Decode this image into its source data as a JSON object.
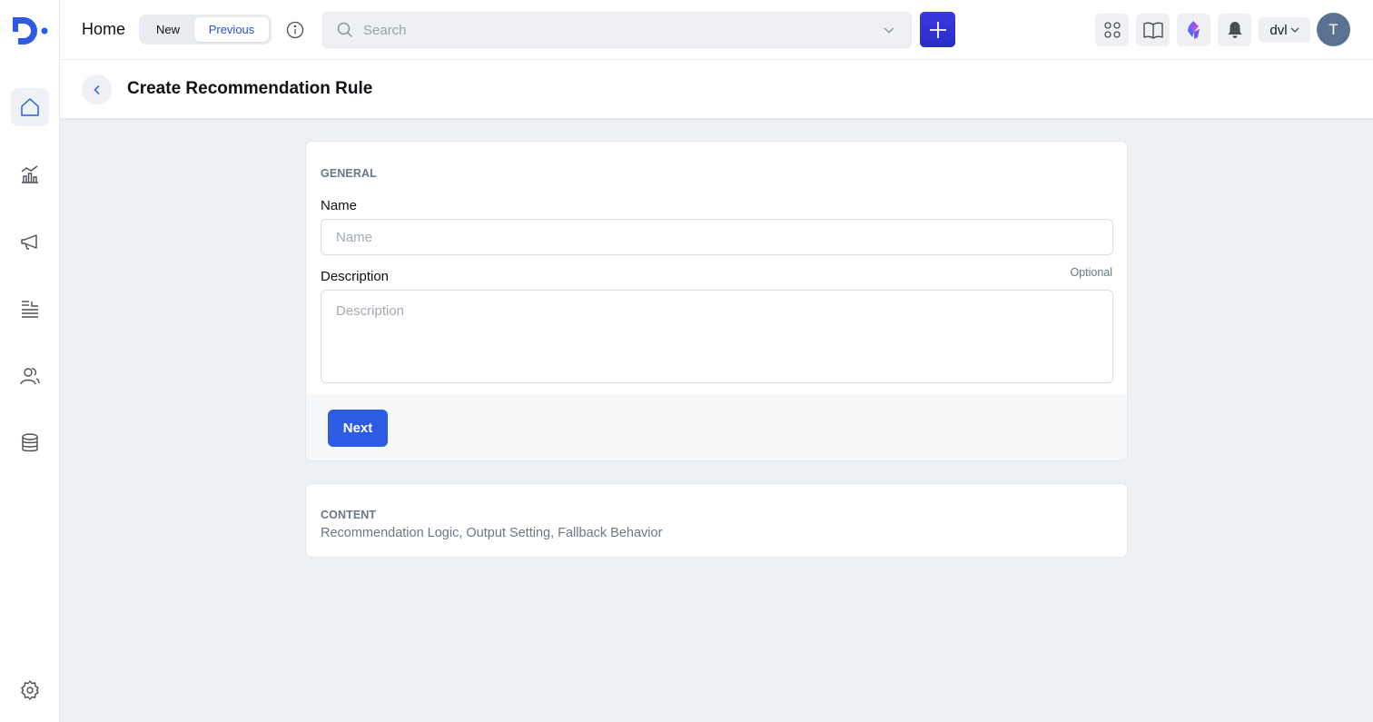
{
  "topbar": {
    "home_label": "Home",
    "segment": {
      "new_label": "New",
      "previous_label": "Previous",
      "selected": "Previous"
    },
    "search": {
      "placeholder": "Search"
    },
    "user_select_label": "dvl",
    "avatar_initial": "T"
  },
  "page": {
    "title": "Create Recommendation Rule"
  },
  "general": {
    "section_label": "GENERAL",
    "name_label": "Name",
    "name_placeholder": "Name",
    "description_label": "Description",
    "optional_label": "Optional",
    "description_placeholder": "Description",
    "next_label": "Next"
  },
  "content": {
    "section_label": "CONTENT",
    "summary": "Recommendation Logic, Output Setting, Fallback Behavior"
  },
  "colors": {
    "brand": "#2d5be3",
    "plus_button": "#3a39e0",
    "avatar": "#5a7191",
    "page_bg": "#eef1f4"
  },
  "icons": {
    "sidebar": [
      "home-icon",
      "analytics-icon",
      "megaphone-icon",
      "list-icon",
      "users-icon",
      "database-icon",
      "settings-icon"
    ],
    "topbar": [
      "info-icon",
      "search-icon",
      "chevron-down-icon",
      "plus-icon",
      "apps-grid-icon",
      "book-icon",
      "gem-icon",
      "bell-icon"
    ]
  }
}
